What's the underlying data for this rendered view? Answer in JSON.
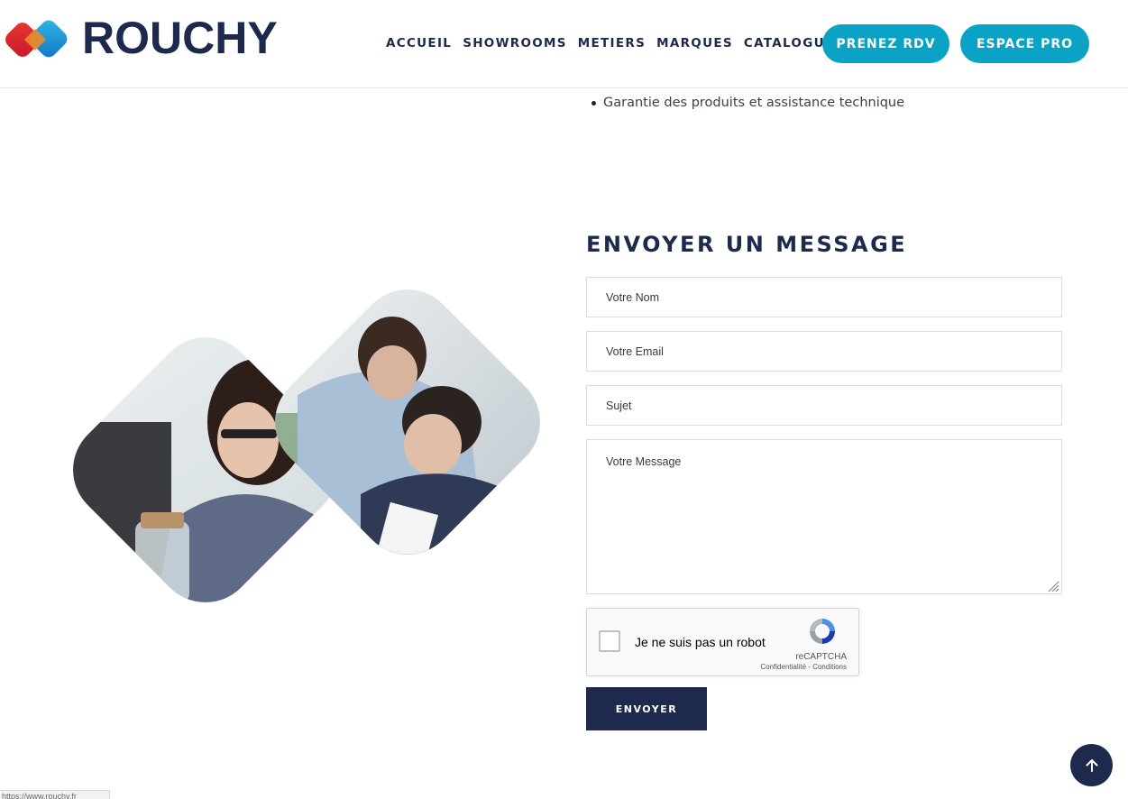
{
  "header": {
    "logo_text": "ROUCHY",
    "nav": [
      "ACCUEIL",
      "SHOWROOMS",
      "METIERS",
      "MARQUES",
      "CATALOGUES"
    ],
    "cta_rdv": "PRENEZ RDV",
    "cta_pro": "ESPACE PRO"
  },
  "list": {
    "item": "Garantie des produits et assistance technique"
  },
  "form": {
    "title": "ENVOYER UN MESSAGE",
    "name_placeholder": "Votre Nom",
    "email_placeholder": "Votre Email",
    "subject_placeholder": "Sujet",
    "message_placeholder": "Votre Message",
    "submit_label": "ENVOYER"
  },
  "captcha": {
    "label": "Je ne suis pas un robot",
    "brand": "reCAPTCHA",
    "privacy": "Confidentialité",
    "separator": " - ",
    "terms": "Conditions"
  },
  "statusbar": {
    "url": "https://www.rouchy.fr"
  },
  "colors": {
    "navy": "#1d2a4d",
    "accent": "#0aa3c5"
  }
}
